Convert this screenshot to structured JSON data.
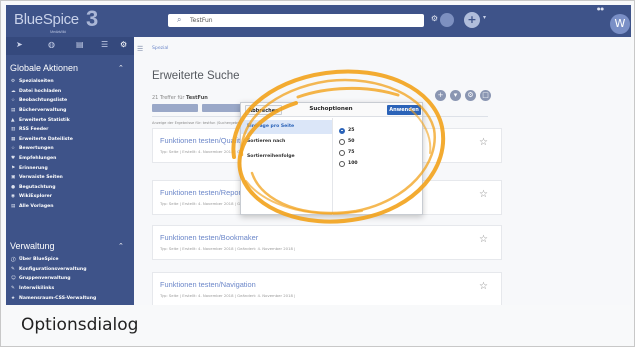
{
  "header": {
    "logo_text": "BlueSpice",
    "logo_version": "3",
    "logo_subtitle": "MediaWiki",
    "search_value": "TestFun",
    "avatar_initial": "W"
  },
  "sidebar": {
    "section1_title": "Globale Aktionen",
    "section1_items": [
      {
        "icon": "⚙",
        "label": "Spezialseiten"
      },
      {
        "icon": "☁",
        "label": "Datei hochladen"
      },
      {
        "icon": "☆",
        "label": "Beobachtungsliste"
      },
      {
        "icon": "▤",
        "label": "Bücherverwaltung"
      },
      {
        "icon": "▲",
        "label": "Erweiterte Statistik"
      },
      {
        "icon": "▥",
        "label": "RSS Feeder"
      },
      {
        "icon": "▦",
        "label": "Erweiterte Dateiliste"
      },
      {
        "icon": "☆",
        "label": "Bewertungen"
      },
      {
        "icon": "♥",
        "label": "Empfehlungen"
      },
      {
        "icon": "⚑",
        "label": "Erinnerung"
      },
      {
        "icon": "▣",
        "label": "Verwaiste Seiten"
      },
      {
        "icon": "●",
        "label": "Begutachtung"
      },
      {
        "icon": "◉",
        "label": "WikiExplorer"
      },
      {
        "icon": "▤",
        "label": "Alle Vorlagen"
      }
    ],
    "section2_title": "Verwaltung",
    "section2_items": [
      {
        "icon": "ⓘ",
        "label": "Über BlueSpice"
      },
      {
        "icon": "✎",
        "label": "Konfigurationsverwaltung"
      },
      {
        "icon": "☺",
        "label": "Gruppenverwaltung"
      },
      {
        "icon": "✎",
        "label": "Interwikilinks"
      },
      {
        "icon": "★",
        "label": "Namensraum-CSS-Verwaltung"
      }
    ]
  },
  "main": {
    "breadcrumb": "Spezial",
    "page_title": "Erweiterte Suche",
    "hits_prefix": "21 Treffer für",
    "hits_term": "TestFun",
    "sort_note": "Anzeige der Ergebnisse für: testfun (Suchergebnis anpassen)",
    "results": [
      {
        "title": "Funktionen testen/Qualitätssicherung",
        "meta": "Typ: Seite | Erstellt: 4. November 2018 | Geändert: 4. November 2018"
      },
      {
        "title": "Funktionen testen/Reporting",
        "meta": "Typ: Seite | Erstellt: 4. November 2018 | Geändert: 4. November 2018"
      },
      {
        "title": "Funktionen testen/Bookmaker",
        "meta": "Typ: Seite | Erstellt: 4. November 2018 | Geändert: 4. November 2018 |"
      },
      {
        "title": "Funktionen testen/Navigation",
        "meta": "Typ: Seite | Erstellt: 4. November 2018 | Geändert: 4. November 2018 |"
      }
    ]
  },
  "dialog": {
    "cancel_label": "Abbrechen",
    "title": "Suchoptionen",
    "apply_label": "Anwenden",
    "options": [
      "Einträge pro Seite",
      "Sortieren nach",
      "Sortierreihenfolge"
    ],
    "page_sizes": [
      "25",
      "50",
      "75",
      "100"
    ],
    "selected_page_size": "25"
  },
  "caption": "Optionsdialog",
  "colors": {
    "header_bg": "#3e5389",
    "accent": "#2b63b8",
    "highlight": "#f2a21b"
  }
}
